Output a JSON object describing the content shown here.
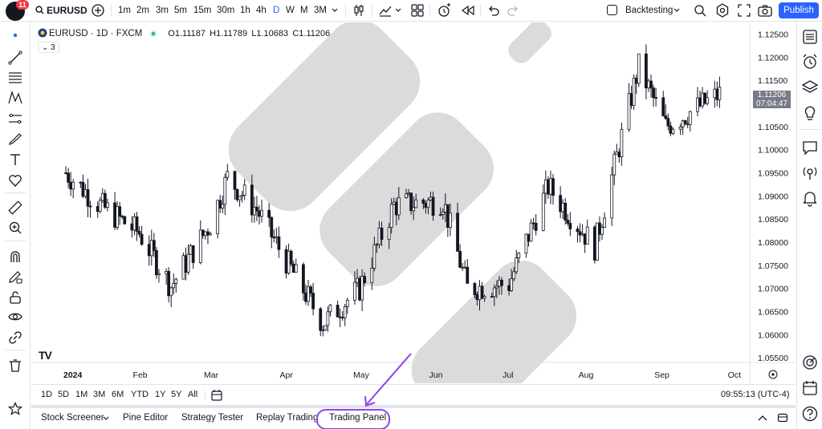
{
  "header": {
    "notification_count": "11",
    "symbol": "EURUSD",
    "intervals": [
      "1m",
      "2m",
      "3m",
      "5m",
      "15m",
      "30m",
      "1h",
      "4h",
      "D",
      "W",
      "M",
      "3M"
    ],
    "active_interval": "D",
    "backtesting_label": "Backtesting",
    "publish_label": "Publish"
  },
  "legend": {
    "symbol_line": "EURUSD · 1D · FXCM",
    "open": "O1.11187",
    "high": "H1.11789",
    "low": "L1.10683",
    "close": "C1.11206",
    "indicator_count": "3"
  },
  "price_axis": {
    "ticks": [
      "1.12500",
      "1.12000",
      "1.11500",
      "1.11000",
      "1.10500",
      "1.10000",
      "1.09500",
      "1.09000",
      "1.08500",
      "1.08000",
      "1.07500",
      "1.07000",
      "1.06500",
      "1.06000",
      "1.05500"
    ],
    "last_price": "1.11206",
    "countdown": "07:04:47"
  },
  "time_axis": {
    "labels": [
      "2024",
      "Feb",
      "Mar",
      "Apr",
      "May",
      "Jun",
      "Jul",
      "Aug",
      "Sep",
      "Oct"
    ]
  },
  "range_bar": {
    "ranges": [
      "1D",
      "5D",
      "1M",
      "3M",
      "6M",
      "YTD",
      "1Y",
      "5Y",
      "All"
    ],
    "clock": "09:55:13 (UTC-4)"
  },
  "bottom_tabs": [
    "Stock Screener",
    "Pine Editor",
    "Strategy Tester",
    "Replay Trading",
    "Trading Panel"
  ],
  "colors": {
    "accent": "#2962ff",
    "annotation": "#8e44e8",
    "candle": "#131722",
    "up_dot": "#22ab94"
  },
  "chart_data": {
    "type": "candlestick",
    "y_range": [
      1.054,
      1.1275
    ],
    "last_close": 1.11206,
    "close_path": [
      {
        "date": "2024-01-02",
        "close": 1.095
      },
      {
        "date": "2024-01-16",
        "close": 1.088
      },
      {
        "date": "2024-02-01",
        "close": 1.082
      },
      {
        "date": "2024-02-14",
        "close": 1.0705
      },
      {
        "date": "2024-03-01",
        "close": 1.084
      },
      {
        "date": "2024-03-08",
        "close": 1.094
      },
      {
        "date": "2024-03-20",
        "close": 1.087
      },
      {
        "date": "2024-04-01",
        "close": 1.076
      },
      {
        "date": "2024-04-16",
        "close": 1.0625
      },
      {
        "date": "2024-05-01",
        "close": 1.07
      },
      {
        "date": "2024-05-15",
        "close": 1.088
      },
      {
        "date": "2024-06-04",
        "close": 1.089
      },
      {
        "date": "2024-06-14",
        "close": 1.07
      },
      {
        "date": "2024-07-01",
        "close": 1.071
      },
      {
        "date": "2024-07-17",
        "close": 1.092
      },
      {
        "date": "2024-08-05",
        "close": 1.079
      },
      {
        "date": "2024-08-23",
        "close": 1.118
      },
      {
        "date": "2024-09-03",
        "close": 1.105
      },
      {
        "date": "2024-09-25",
        "close": 1.112
      }
    ]
  }
}
